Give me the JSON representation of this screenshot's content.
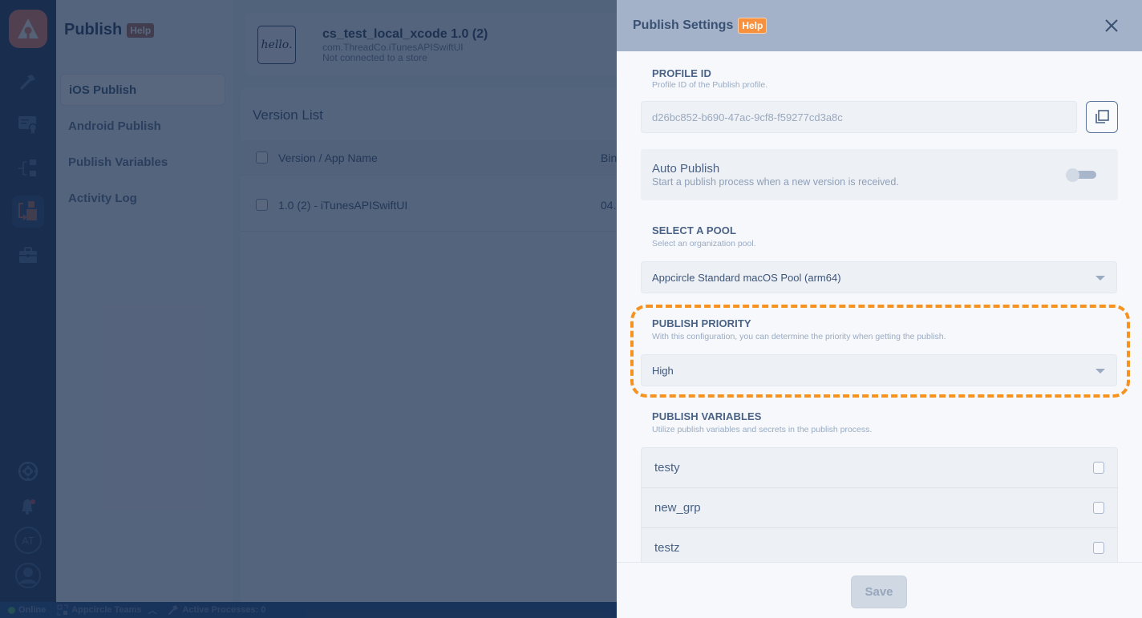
{
  "rail": {
    "items": [
      {
        "icon": "hammer-icon"
      },
      {
        "icon": "certificate-icon"
      },
      {
        "icon": "distribute-icon"
      },
      {
        "icon": "publish-module-icon",
        "active": true
      },
      {
        "icon": "briefcase-icon"
      }
    ],
    "bottom": {
      "help_icon": "lifebuoy-icon",
      "notification_icon": "bell-icon",
      "avatar_initials": "AT",
      "profile_icon": "user-icon"
    }
  },
  "subnav": {
    "title": "Publish",
    "help": "Help",
    "items": [
      {
        "label": "iOS Publish",
        "active": true
      },
      {
        "label": "Android Publish"
      },
      {
        "label": "Publish Variables"
      },
      {
        "label": "Activity Log"
      }
    ]
  },
  "app": {
    "icon_text": "hello.",
    "name": "cs_test_local_xcode 1.0 (2)",
    "bundle": "com.ThreadCo.iTunesAPISwiftUI",
    "store_status": "Not connected to a store"
  },
  "version_list": {
    "title": "Version List",
    "columns": [
      "Version / App Name",
      "Bin"
    ],
    "rows": [
      {
        "name": "1.0 (2) - iTunesAPISwiftUI",
        "binary": "04."
      }
    ]
  },
  "statusbar": {
    "online": "Online",
    "team": "Appcircle Teams",
    "processes": "Active Processes: 0"
  },
  "drawer": {
    "title": "Publish Settings",
    "help": "Help",
    "profile_id": {
      "label": "PROFILE ID",
      "desc": "Profile ID of the Publish profile.",
      "value": "d26bc852-b690-47ac-9cf8-f59277cd3a8c"
    },
    "auto_publish": {
      "label": "Auto Publish",
      "desc": "Start a publish process when a new version is received.",
      "enabled": false
    },
    "pool": {
      "label": "SELECT A POOL",
      "desc": "Select an organization pool.",
      "value": "Appcircle Standard macOS Pool (arm64)"
    },
    "priority": {
      "label": "PUBLISH PRIORITY",
      "desc": "With this configuration, you can determine the priority when getting the publish.",
      "value": "High"
    },
    "variables": {
      "label": "PUBLISH VARIABLES",
      "desc": "Utilize publish variables and secrets in the publish process.",
      "items": [
        {
          "name": "testy",
          "checked": false
        },
        {
          "name": "new_grp",
          "checked": false
        },
        {
          "name": "testz",
          "checked": false
        }
      ]
    },
    "save": "Save"
  },
  "colors": {
    "accent_orange": "#f7921f",
    "help_badge": "#f7913d",
    "drawer_header": "#a3b2c9",
    "rail": "#1d3354"
  }
}
